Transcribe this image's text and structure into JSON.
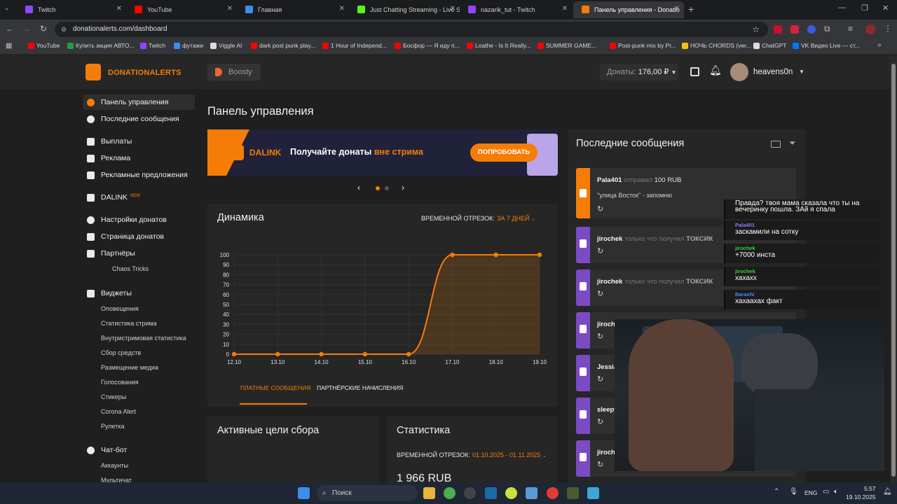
{
  "browser": {
    "tabs": [
      {
        "title": "Twitch",
        "icon": "twitch-icon",
        "color": "#9146ff"
      },
      {
        "title": "YouTube",
        "icon": "youtube-icon",
        "color": "#ff0000"
      },
      {
        "title": "Главная",
        "icon": "home-icon",
        "color": "#3a8ef0"
      },
      {
        "title": "Just Chatting Streaming - Live S",
        "icon": "kick-icon",
        "color": "#53fc18"
      },
      {
        "title": "nazarik_tut - Twitch",
        "icon": "twitch-icon",
        "color": "#9146ff"
      },
      {
        "title": "Панель управления - Donatio",
        "icon": "donationalerts-icon",
        "color": "#f57d07"
      }
    ],
    "url": "donationalerts.com/dashboard",
    "bookmarks": [
      {
        "label": "YouTube",
        "color": "#ff0000"
      },
      {
        "label": "Купить акция АВТО...",
        "color": "#21a038"
      },
      {
        "label": "Twitch",
        "color": "#9146ff"
      },
      {
        "label": "футажи",
        "color": "#3a8ef0"
      },
      {
        "label": "Viggle AI",
        "color": "#dddddd"
      },
      {
        "label": "dark post punk play...",
        "color": "#ff0000"
      },
      {
        "label": "1 Hour of Independ...",
        "color": "#ff0000"
      },
      {
        "label": "Босфор — Я иду п...",
        "color": "#ff0000"
      },
      {
        "label": "Loathe - Is It Really...",
        "color": "#ff0000"
      },
      {
        "label": "SUMMER GAME...",
        "color": "#ff0000"
      },
      {
        "label": "Post-punk mix by Pr...",
        "color": "#ff0000"
      },
      {
        "label": "НОЧЬ CHORDS (ver...",
        "color": "#f1c40f"
      },
      {
        "label": "ChatGPT",
        "color": "#dddddd"
      },
      {
        "label": "VK Видео Live — ст...",
        "color": "#0077ff"
      }
    ]
  },
  "header": {
    "logo_text": "DONATIONALERTS",
    "boosty_label": "Boosty",
    "donats_label": "Донаты:",
    "donats_value": "176,00 ₽",
    "username": "heavens0n"
  },
  "sidebar": {
    "items": [
      {
        "label": "Панель управления",
        "icon": "dashboard-icon",
        "active": true
      },
      {
        "label": "Последние сообщения",
        "icon": "star-icon"
      },
      {
        "label": "Выплаты",
        "icon": "wallet-icon"
      },
      {
        "label": "Реклама",
        "icon": "ads-icon"
      },
      {
        "label": "Рекламные предложения",
        "icon": "offers-icon"
      },
      {
        "label": "DALINK",
        "icon": "dalink-icon",
        "badge": "NEW"
      },
      {
        "label": "Настройки донатов",
        "icon": "gear-icon"
      },
      {
        "label": "Страница донатов",
        "icon": "page-icon"
      },
      {
        "label": "Партнёры",
        "icon": "partners-icon"
      },
      {
        "label": "Виджеты",
        "icon": "widgets-icon"
      },
      {
        "label": "Чат-бот",
        "icon": "chatbot-icon"
      }
    ],
    "partners_sub": [
      "Chaos Tricks"
    ],
    "widgets_sub": [
      "Оповещения",
      "Статистика стрима",
      "Внутристримовая статистика",
      "Сбор средств",
      "Размещение медиа",
      "Голосования",
      "Стикеры",
      "Corona Alert",
      "Рулетка"
    ],
    "chatbot_sub": [
      "Аккаунты",
      "Мультичат"
    ]
  },
  "main": {
    "title": "Панель управления",
    "banner": {
      "brand": "DALINK",
      "text_main": "Получайте донаты",
      "text_accent": "вне стрима",
      "button": "ПОПРОБОВАТЬ"
    },
    "dynamics": {
      "title": "Динамика",
      "period_label": "ВРЕМЕННОЙ ОТРЕЗОК:",
      "period_value": "ЗА 7 ДНЕЙ",
      "tab_paid": "ПЛАТНЫЕ СООБЩЕНИЯ",
      "tab_partner": "ПАРТНЁРСКИЕ НАЧИСЛЕНИЯ"
    },
    "goals": {
      "title": "Активные цели сбора"
    },
    "stats": {
      "title": "Статистика",
      "period_label": "ВРЕМЕННОЙ ОТРЕЗОК:",
      "period_value": "01.10.2025 - 01.11.2025",
      "total": "1 966 RUB"
    }
  },
  "chart_data": {
    "type": "line",
    "x": [
      "12.10",
      "13.10",
      "14.10",
      "15.10",
      "16.10",
      "17.10",
      "18.10",
      "19.10"
    ],
    "series": [
      {
        "values": [
          0,
          0,
          0,
          0,
          0,
          100,
          100,
          100
        ]
      }
    ],
    "ylim": [
      0,
      100
    ],
    "yticks": [
      0,
      10,
      20,
      30,
      40,
      50,
      60,
      70,
      80,
      90,
      100
    ],
    "grid": true,
    "color": "#f57d07"
  },
  "messages": {
    "title": "Последние сообщения",
    "items": [
      {
        "user": "Pala401",
        "action": "отправил",
        "amount": "100 RUB",
        "text": "\"улица Восток\" - запомню",
        "type": "donation",
        "color": "#f57d07"
      },
      {
        "user": "jirochek",
        "action": "только что получил",
        "amount": "ТОКСИК",
        "type": "twitch",
        "color": "#7b4bc4"
      },
      {
        "user": "jirochek",
        "action": "только что получил",
        "amount": "ТОКСИК",
        "type": "twitch",
        "color": "#7b4bc4"
      },
      {
        "user": "jiroch",
        "action": "",
        "amount": "",
        "type": "twitch",
        "color": "#7b4bc4"
      },
      {
        "user": "JessiJ",
        "action": "",
        "amount": "",
        "type": "twitch",
        "color": "#7b4bc4"
      },
      {
        "user": "sleepy",
        "action": "",
        "amount": "",
        "type": "twitch",
        "color": "#7b4bc4"
      },
      {
        "user": "jiroch",
        "action": "",
        "amount": "",
        "type": "twitch",
        "color": "#7b4bc4"
      }
    ]
  },
  "stream_chat": [
    {
      "user": "",
      "text": "Правда? твоя мама сказала что ты на",
      "text2": "вечеринку пошла. ЗАй я спала",
      "color": "#ffffff"
    },
    {
      "user": "Pala401",
      "text": "заскамили на сотку",
      "color": "#8a7cff"
    },
    {
      "user": "jirochek",
      "text": "+7000 инста",
      "color": "#3ad13a"
    },
    {
      "user": "jirochek",
      "text": "хахахх",
      "color": "#3ad13a"
    },
    {
      "user": "Barashi",
      "text": "хахаахах факт",
      "color": "#4a8cff"
    }
  ],
  "taskbar": {
    "search_placeholder": "Поиск",
    "lang": "ENG",
    "time": "5:57",
    "date": "19.10.2025"
  }
}
